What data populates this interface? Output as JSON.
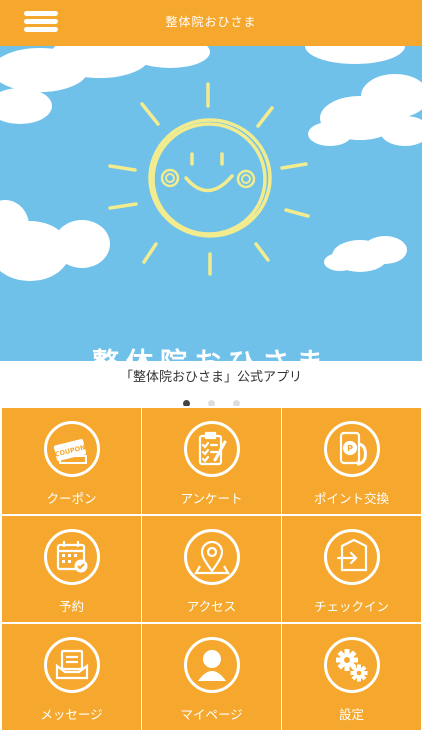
{
  "header": {
    "title": "整体院おひさま",
    "menu_icon": "hamburger-menu-icon"
  },
  "banner": {
    "title": "整体院おひさま",
    "illustration": "smiling-sun-with-clouds"
  },
  "caption": "「整体院おひさま」公式アプリ",
  "carousel": {
    "slides": 3,
    "active": 1
  },
  "coupon_stamp": "COUPON",
  "menu": [
    {
      "label": "クーポン",
      "icon": "coupon-icon"
    },
    {
      "label": "アンケート",
      "icon": "clipboard-survey-icon"
    },
    {
      "label": "ポイント交換",
      "icon": "point-exchange-phone-icon"
    },
    {
      "label": "予約",
      "icon": "calendar-check-icon"
    },
    {
      "label": "アクセス",
      "icon": "map-pin-icon"
    },
    {
      "label": "チェックイン",
      "icon": "checkin-door-icon"
    },
    {
      "label": "メッセージ",
      "icon": "message-inbox-icon"
    },
    {
      "label": "マイページ",
      "icon": "user-profile-icon"
    },
    {
      "label": "設定",
      "icon": "gear-settings-icon"
    }
  ],
  "colors": {
    "accent": "#f5a82d",
    "sky": "#6fc1ea",
    "sun": "#f2ec8f",
    "white": "#ffffff"
  }
}
